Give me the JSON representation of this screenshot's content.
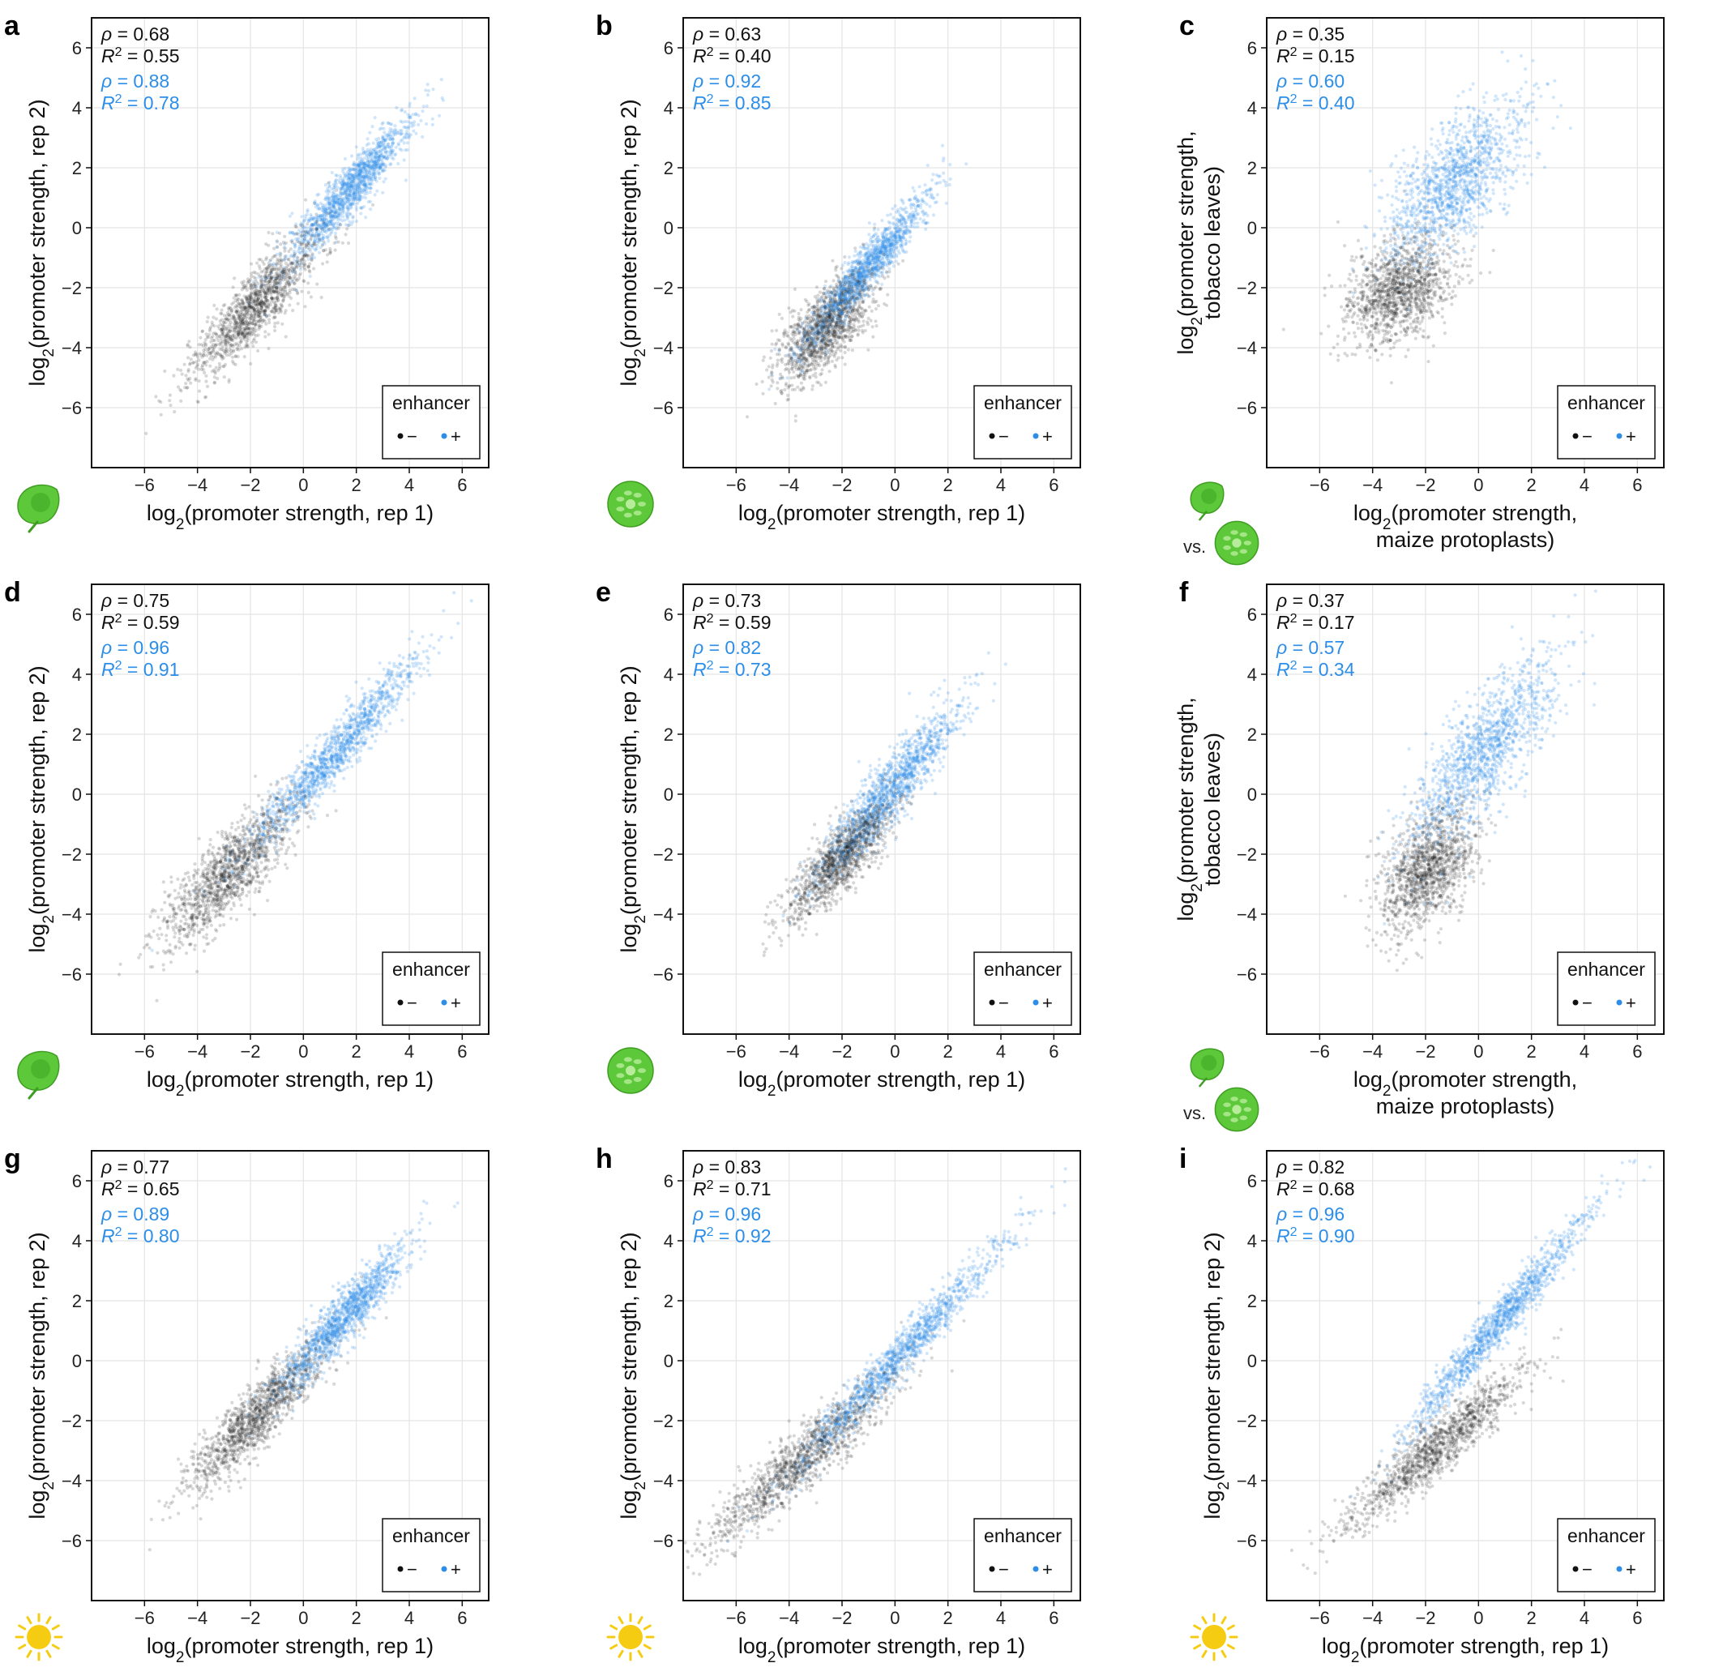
{
  "colors": {
    "negative": "#111111",
    "positive": "#2c8ee8",
    "leaf": "#5cc83a",
    "sun": "#f6cc12"
  },
  "legend": {
    "title": "enhancer",
    "neg_label": "−",
    "pos_label": "+"
  },
  "axes": {
    "xlim": [
      -8,
      7
    ],
    "ylim": [
      -8,
      7
    ],
    "ticks": [
      -6,
      -4,
      -2,
      0,
      2,
      4,
      6
    ],
    "grid": true,
    "legend_position": "bottom-right"
  },
  "vs_label": "vs.",
  "chart_data": [
    {
      "letter": "a",
      "type": "scatter",
      "icon": "leaf-icon",
      "xlabel": [
        "log2(promoter strength, rep 1)"
      ],
      "ylabel": [
        "log2(promoter strength, rep 2)"
      ],
      "stats": {
        "neg": {
          "rho": "0.68",
          "r2": "0.55"
        },
        "pos": {
          "rho": "0.88",
          "r2": "0.78"
        }
      },
      "series": [
        {
          "enhancer": "−",
          "center": [
            -1.8,
            -2.6
          ],
          "spread": [
            1.3,
            1.1
          ],
          "slope": 0.85,
          "noise": 0.6
        },
        {
          "enhancer": "+",
          "center": [
            1.8,
            1.3
          ],
          "spread": [
            1.2,
            1.2
          ],
          "slope": 0.95,
          "noise": 0.45
        }
      ]
    },
    {
      "letter": "b",
      "type": "scatter",
      "icon": "protoplast-icon",
      "xlabel": [
        "log2(promoter strength, rep 1)"
      ],
      "ylabel": [
        "log2(promoter strength, rep 2)"
      ],
      "stats": {
        "neg": {
          "rho": "0.63",
          "r2": "0.40"
        },
        "pos": {
          "rho": "0.92",
          "r2": "0.85"
        }
      },
      "series": [
        {
          "enhancer": "−",
          "center": [
            -2.6,
            -3.3
          ],
          "spread": [
            0.9,
            0.9
          ],
          "slope": 0.7,
          "noise": 0.65
        },
        {
          "enhancer": "+",
          "center": [
            -1.0,
            -1.3
          ],
          "spread": [
            1.2,
            1.2
          ],
          "slope": 1.0,
          "noise": 0.4
        }
      ]
    },
    {
      "letter": "c",
      "type": "scatter",
      "icon": "leaf-vs-protoplast-icon",
      "xlabel": [
        "log2(promoter strength,",
        "maize protoplasts)"
      ],
      "ylabel": [
        "log2(promoter strength,",
        "tobacco leaves)"
      ],
      "stats": {
        "neg": {
          "rho": "0.35",
          "r2": "0.15"
        },
        "pos": {
          "rho": "0.60",
          "r2": "0.40"
        }
      },
      "series": [
        {
          "enhancer": "−",
          "center": [
            -3.0,
            -2.1
          ],
          "spread": [
            1.0,
            0.8
          ],
          "slope": 0.3,
          "noise": 0.85
        },
        {
          "enhancer": "+",
          "center": [
            -0.8,
            1.6
          ],
          "spread": [
            1.3,
            1.3
          ],
          "slope": 0.65,
          "noise": 1.0
        }
      ]
    },
    {
      "letter": "d",
      "type": "scatter",
      "icon": "leaf-icon",
      "xlabel": [
        "log2(promoter strength, rep 1)"
      ],
      "ylabel": [
        "log2(promoter strength, rep 2)"
      ],
      "stats": {
        "neg": {
          "rho": "0.75",
          "r2": "0.59"
        },
        "pos": {
          "rho": "0.96",
          "r2": "0.91"
        }
      },
      "series": [
        {
          "enhancer": "−",
          "center": [
            -2.8,
            -2.6
          ],
          "spread": [
            1.3,
            1.3
          ],
          "slope": 0.8,
          "noise": 0.7
        },
        {
          "enhancer": "+",
          "center": [
            1.2,
            1.4
          ],
          "spread": [
            1.6,
            1.6
          ],
          "slope": 0.95,
          "noise": 0.45
        }
      ]
    },
    {
      "letter": "e",
      "type": "scatter",
      "icon": "protoplast-icon",
      "xlabel": [
        "log2(promoter strength, rep 1)"
      ],
      "ylabel": [
        "log2(promoter strength, rep 2)"
      ],
      "stats": {
        "neg": {
          "rho": "0.73",
          "r2": "0.59"
        },
        "pos": {
          "rho": "0.82",
          "r2": "0.73"
        }
      },
      "series": [
        {
          "enhancer": "−",
          "center": [
            -2.0,
            -2.1
          ],
          "spread": [
            1.0,
            1.0
          ],
          "slope": 0.85,
          "noise": 0.55
        },
        {
          "enhancer": "+",
          "center": [
            -0.2,
            0.1
          ],
          "spread": [
            1.3,
            1.3
          ],
          "slope": 1.0,
          "noise": 0.55
        }
      ]
    },
    {
      "letter": "f",
      "type": "scatter",
      "icon": "leaf-vs-protoplast-icon",
      "xlabel": [
        "log2(promoter strength,",
        "maize protoplasts)"
      ],
      "ylabel": [
        "log2(promoter strength,",
        "tobacco leaves)"
      ],
      "stats": {
        "neg": {
          "rho": "0.37",
          "r2": "0.17"
        },
        "pos": {
          "rho": "0.57",
          "r2": "0.34"
        }
      },
      "series": [
        {
          "enhancer": "−",
          "center": [
            -1.9,
            -2.5
          ],
          "spread": [
            0.9,
            1.0
          ],
          "slope": 0.5,
          "noise": 0.9
        },
        {
          "enhancer": "+",
          "center": [
            0.2,
            1.4
          ],
          "spread": [
            1.4,
            1.4
          ],
          "slope": 0.9,
          "noise": 1.0
        }
      ]
    },
    {
      "letter": "g",
      "type": "scatter",
      "icon": "sun-icon",
      "xlabel": [
        "log2(promoter strength, rep 1)"
      ],
      "ylabel": [
        "log2(promoter strength, rep 2)"
      ],
      "stats": {
        "neg": {
          "rho": "0.77",
          "r2": "0.65"
        },
        "pos": {
          "rho": "0.89",
          "r2": "0.80"
        }
      },
      "series": [
        {
          "enhancer": "−",
          "center": [
            -1.8,
            -1.9
          ],
          "spread": [
            1.3,
            1.2
          ],
          "slope": 0.85,
          "noise": 0.55
        },
        {
          "enhancer": "+",
          "center": [
            1.5,
            1.4
          ],
          "spread": [
            1.2,
            1.2
          ],
          "slope": 0.95,
          "noise": 0.45
        }
      ]
    },
    {
      "letter": "h",
      "type": "scatter",
      "icon": "sun-icon",
      "xlabel": [
        "log2(promoter strength, rep 1)"
      ],
      "ylabel": [
        "log2(promoter strength, rep 2)"
      ],
      "stats": {
        "neg": {
          "rho": "0.83",
          "r2": "0.71"
        },
        "pos": {
          "rho": "0.96",
          "r2": "0.92"
        }
      },
      "series": [
        {
          "enhancer": "−",
          "center": [
            -3.5,
            -3.3
          ],
          "spread": [
            1.8,
            1.5
          ],
          "slope": 0.75,
          "noise": 0.55
        },
        {
          "enhancer": "+",
          "center": [
            0.2,
            0.2
          ],
          "spread": [
            2.0,
            2.0
          ],
          "slope": 0.95,
          "noise": 0.4
        }
      ]
    },
    {
      "letter": "i",
      "type": "scatter",
      "icon": "sun-icon",
      "xlabel": [
        "log2(promoter strength, rep 1)"
      ],
      "ylabel": [
        "log2(promoter strength, rep 2)"
      ],
      "stats": {
        "neg": {
          "rho": "0.82",
          "r2": "0.68"
        },
        "pos": {
          "rho": "0.96",
          "r2": "0.90"
        }
      },
      "series": [
        {
          "enhancer": "−",
          "center": [
            -1.6,
            -2.9
          ],
          "spread": [
            1.7,
            1.2
          ],
          "slope": 0.72,
          "noise": 0.5
        },
        {
          "enhancer": "+",
          "center": [
            0.8,
            1.3
          ],
          "spread": [
            1.7,
            1.7
          ],
          "slope": 1.05,
          "noise": 0.4
        }
      ]
    }
  ]
}
